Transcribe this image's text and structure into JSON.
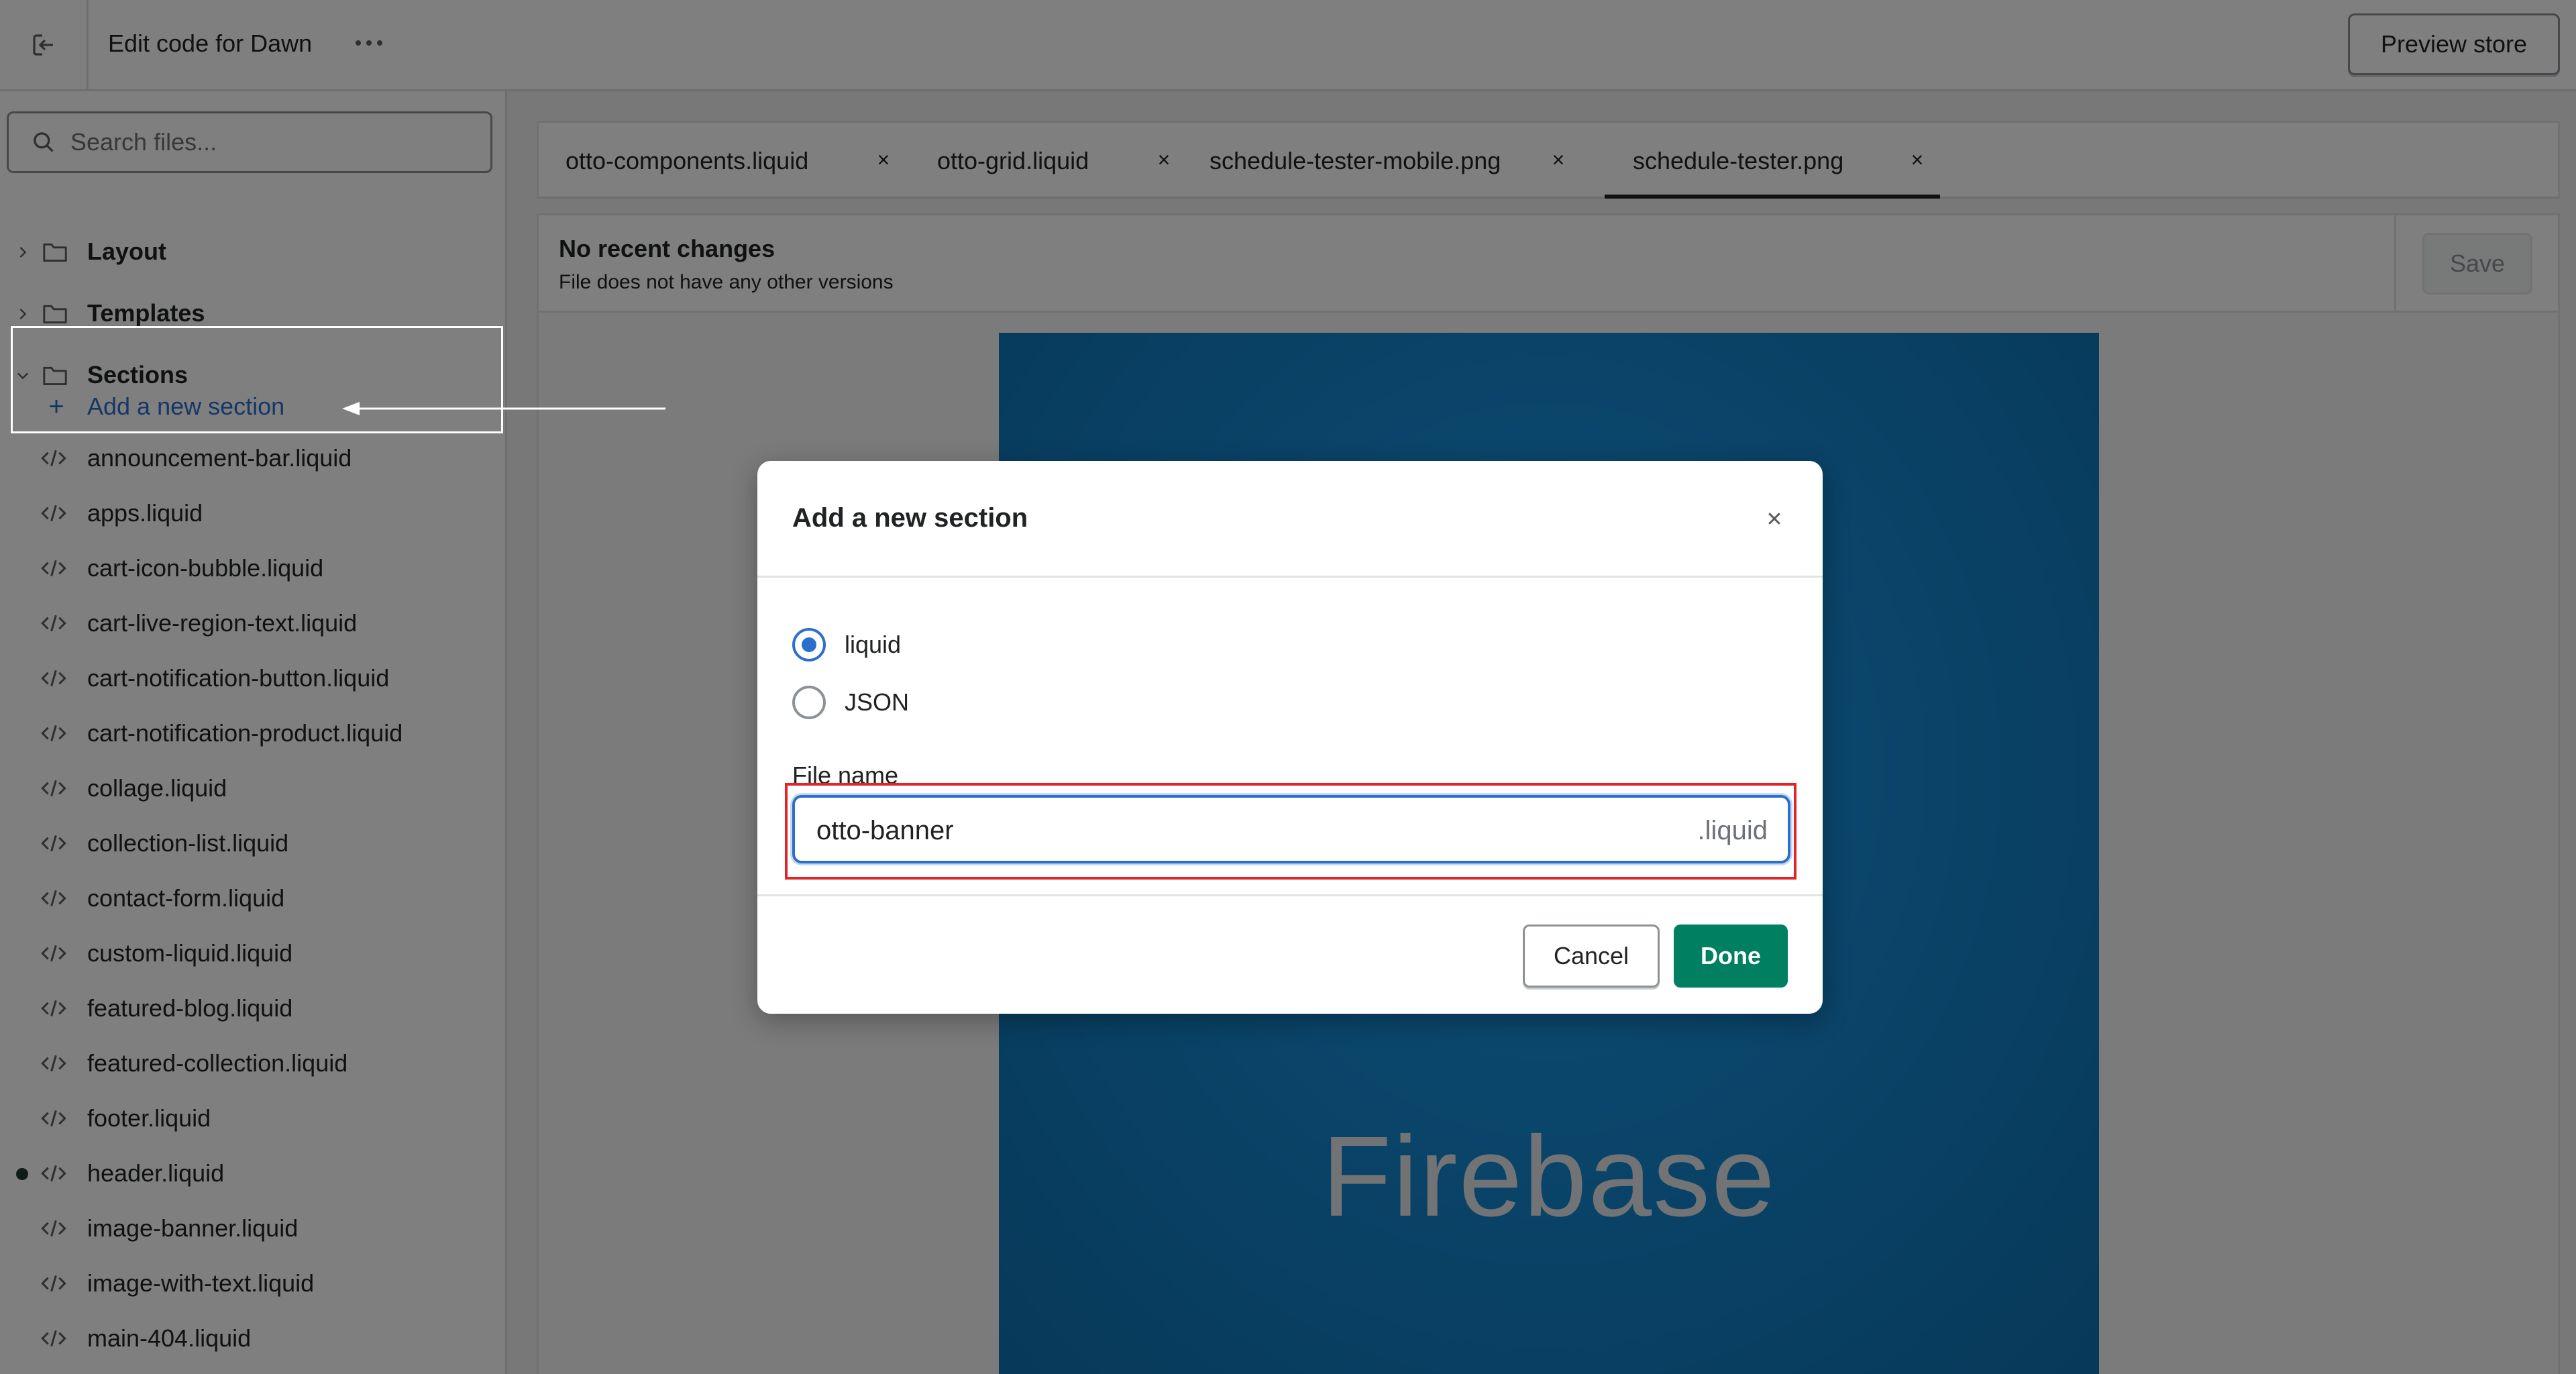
{
  "topbar": {
    "title": "Edit code for Dawn",
    "preview_label": "Preview store",
    "exit_icon": "exit-icon",
    "more_icon": "more-horizontal-icon"
  },
  "sidebar": {
    "search_placeholder": "Search files...",
    "folders": [
      {
        "label": "Layout",
        "expanded": false
      },
      {
        "label": "Templates",
        "expanded": false
      },
      {
        "label": "Sections",
        "expanded": true
      }
    ],
    "add_section_label": "Add a new section",
    "files": [
      {
        "name": "announcement-bar.liquid",
        "modified": false
      },
      {
        "name": "apps.liquid",
        "modified": false
      },
      {
        "name": "cart-icon-bubble.liquid",
        "modified": false
      },
      {
        "name": "cart-live-region-text.liquid",
        "modified": false
      },
      {
        "name": "cart-notification-button.liquid",
        "modified": false
      },
      {
        "name": "cart-notification-product.liquid",
        "modified": false
      },
      {
        "name": "collage.liquid",
        "modified": false
      },
      {
        "name": "collection-list.liquid",
        "modified": false
      },
      {
        "name": "contact-form.liquid",
        "modified": false
      },
      {
        "name": "custom-liquid.liquid",
        "modified": false
      },
      {
        "name": "featured-blog.liquid",
        "modified": false
      },
      {
        "name": "featured-collection.liquid",
        "modified": false
      },
      {
        "name": "footer.liquid",
        "modified": false
      },
      {
        "name": "header.liquid",
        "modified": true
      },
      {
        "name": "image-banner.liquid",
        "modified": false
      },
      {
        "name": "image-with-text.liquid",
        "modified": false
      },
      {
        "name": "main-404.liquid",
        "modified": false
      }
    ]
  },
  "tabs": [
    {
      "label": "otto-components.liquid",
      "close": "×",
      "active": false
    },
    {
      "label": "otto-grid.liquid",
      "close": "×",
      "active": false
    },
    {
      "label": "schedule-tester-mobile.png",
      "close": "×",
      "active": false
    },
    {
      "label": "schedule-tester.png",
      "close": "×",
      "active": true
    }
  ],
  "info": {
    "title": "No recent changes",
    "subtitle": "File does not have any other versions",
    "save_label": "Save"
  },
  "preview": {
    "image_text": "Firebase"
  },
  "modal": {
    "title": "Add a new section",
    "options": [
      {
        "label": "liquid",
        "checked": true
      },
      {
        "label": "JSON",
        "checked": false
      }
    ],
    "file_name_label": "File name",
    "file_name_value": "otto-banner",
    "file_suffix": ".liquid",
    "cancel_label": "Cancel",
    "done_label": "Done"
  },
  "colors": {
    "accent": "#2c6ecb",
    "primary_button": "#008060",
    "annotation_red": "#e0242a",
    "modified_dot": "#1f3b2f"
  }
}
